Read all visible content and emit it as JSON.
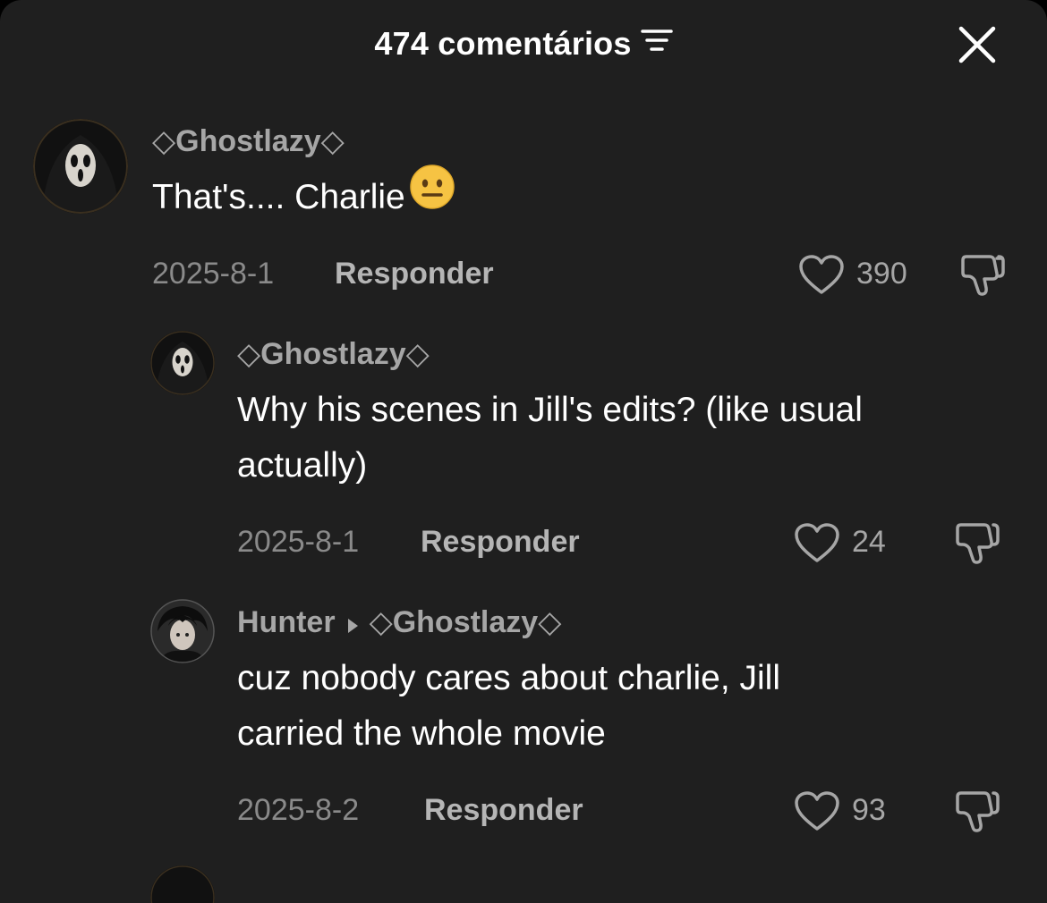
{
  "header": {
    "title": "474 comentários",
    "sort_icon": "sort-lines-icon",
    "close_icon": "close-icon"
  },
  "comments": [
    {
      "username": "◇Ghostlazy◇",
      "text_lines": [
        "That's.... Charlie"
      ],
      "emoji": "neutral-face-emoji",
      "date": "2025-8-1",
      "reply_label": "Responder",
      "likes": "390"
    },
    {
      "username": "◇Ghostlazy◇",
      "text_lines": [
        "Why his scenes in Jill's edits? (like usual",
        "actually)"
      ],
      "date": "2025-8-1",
      "reply_label": "Responder",
      "likes": "24"
    },
    {
      "username": "Hunter",
      "reply_to": "◇Ghostlazy◇",
      "text_lines": [
        "cuz nobody cares about charlie, Jill",
        "carried the whole movie"
      ],
      "date": "2025-8-2",
      "reply_label": "Responder",
      "likes": "93"
    }
  ],
  "colors": {
    "background": "#1f1f1f",
    "text": "#ffffff",
    "muted": "#8a8a8a",
    "username": "#a6a6a6"
  }
}
